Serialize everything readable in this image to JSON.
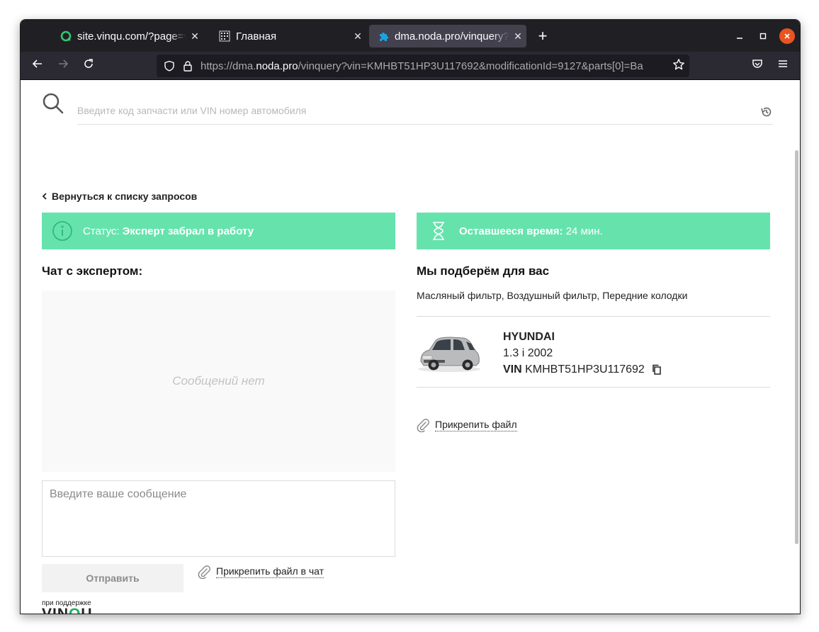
{
  "browser": {
    "tabs": [
      {
        "title": "site.vinqu.com/?page=vinq",
        "icon": "vinqu-favicon",
        "active": false
      },
      {
        "title": "Главная",
        "icon": "grid-favicon",
        "active": false
      },
      {
        "title": "dma.noda.pro/vinquery?vin=",
        "icon": "puzzle-favicon",
        "active": true
      }
    ],
    "close_glyph": "✕",
    "new_tab_glyph": "+",
    "url_prefix": "https://dma.",
    "url_host": "noda.pro",
    "url_path": "/vinquery?vin=KMHBT51HP3U117692&modificationId=9127&parts[0]=Ba",
    "colors": {
      "tabstrip": "#202024",
      "navbar": "#2b2a33",
      "urlbar": "#1c1b22",
      "close": "#e95420"
    }
  },
  "search": {
    "placeholder": "Введите код запчасти или VIN номер автомобиля"
  },
  "back_link": "Вернуться к списку запросов",
  "status": {
    "label": "Статус:",
    "value": "Эксперт забрал в работу"
  },
  "time": {
    "label": "Оставшееся время:",
    "value": "24 мин."
  },
  "chat": {
    "title": "Чат с экспертом:",
    "empty": "Сообщений нет",
    "input_placeholder": "Введите ваше сообщение",
    "send_label": "Отправить",
    "attach_label": "Прикрепить файл в чат"
  },
  "selection": {
    "title": "Мы подберём для вас",
    "parts": "Масляный фильтр, Воздушный фильтр, Передние колодки",
    "car": {
      "brand": "HYUNDAI",
      "model": "1.3 i 2002",
      "vin_label": "VIN",
      "vin": "KMHBT51HP3U117692"
    },
    "attach_label": "Прикрепить файл"
  },
  "powered": {
    "small": "при поддержке",
    "logo_pre": "VIN",
    "logo_q": "Q",
    "logo_post": "U"
  },
  "accent_color": "#66e3ad"
}
